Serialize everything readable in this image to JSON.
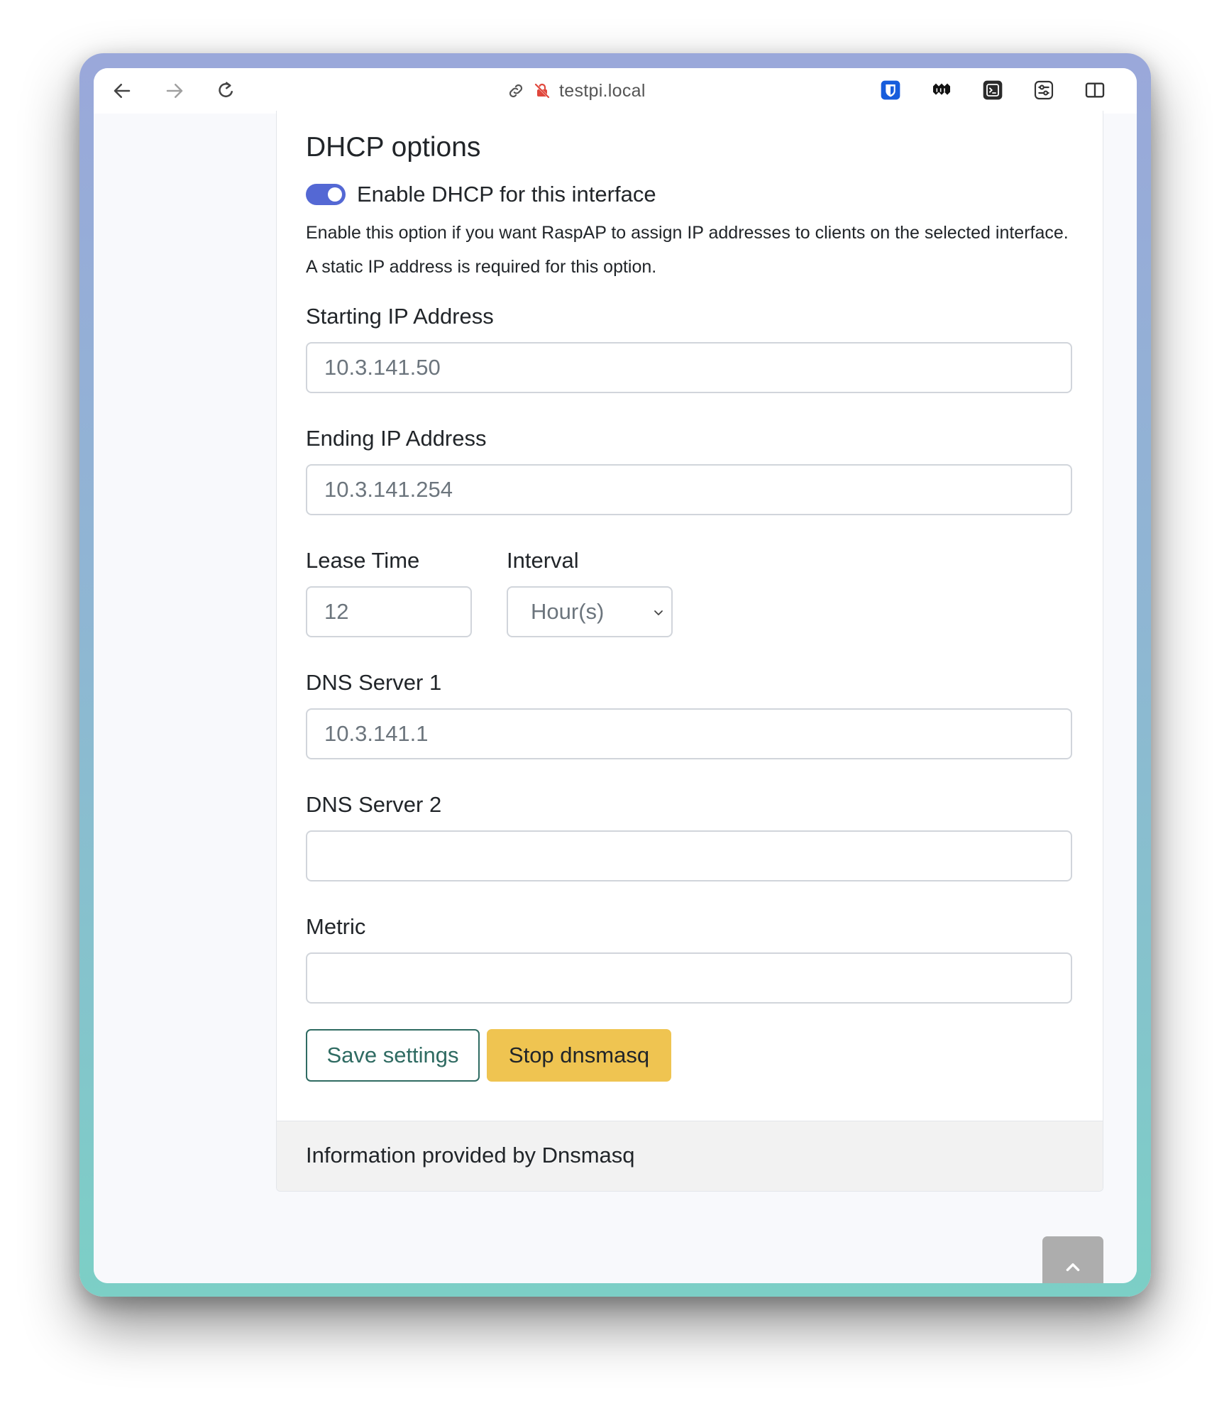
{
  "browser": {
    "url": "testpi.local",
    "icons": {
      "back": "arrow-left-icon",
      "forward": "arrow-right-icon",
      "reload": "reload-icon",
      "link": "link-icon",
      "insecure": "insecure-lock-icon",
      "sidebar": "sidebar-icon"
    },
    "extensions": [
      "bitwarden-icon",
      "extension-icon",
      "terminal-icon",
      "settings-sliders-icon"
    ]
  },
  "dhcp": {
    "title": "DHCP options",
    "enable_label": "Enable DHCP for this interface",
    "enable_checked": true,
    "help_text": "Enable this option if you want RaspAP to assign IP addresses to clients on the selected interface. A static IP address is required for this option.",
    "starting_ip": {
      "label": "Starting IP Address",
      "value": "10.3.141.50"
    },
    "ending_ip": {
      "label": "Ending IP Address",
      "value": "10.3.141.254"
    },
    "lease_time": {
      "label": "Lease Time",
      "value": "12"
    },
    "interval": {
      "label": "Interval",
      "value": "Hour(s)"
    },
    "dns1": {
      "label": "DNS Server 1",
      "value": "10.3.141.1"
    },
    "dns2": {
      "label": "DNS Server 2",
      "value": ""
    },
    "metric": {
      "label": "Metric",
      "value": ""
    },
    "save_label": "Save settings",
    "stop_label": "Stop dnsmasq"
  },
  "footer": {
    "text": "Information provided by Dnsmasq"
  },
  "colors": {
    "toggle": "#5468d4",
    "save_outline": "#2f6b62",
    "warning": "#efc451",
    "scroll_button": "#adadad"
  }
}
